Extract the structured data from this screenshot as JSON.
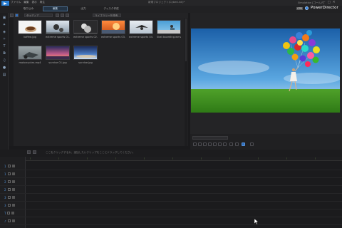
{
  "window": {
    "title": "新規プロジェクト(CyberLink)*",
    "controls": [
      "—",
      "□",
      "✕"
    ]
  },
  "menu": [
    "ファイル",
    "編集",
    "表示",
    "再生"
  ],
  "modes": {
    "capture": "取り込み",
    "edit": "編集",
    "produce": "出力",
    "disc": "ディスク作成"
  },
  "brand": {
    "user": "Simulation [ゴールド]",
    "badge": "CPR",
    "name": "PowerDirector"
  },
  "library": {
    "filter_label": "全メディア",
    "search_placeholder": "ライブラリーを検索",
    "items": [
      {
        "label": "kaffee.jpg"
      },
      {
        "label": "extreme sports 01.jpg"
      },
      {
        "label": "extreme sports 02.jpg"
      },
      {
        "label": "extreme sports 03.jpg"
      },
      {
        "label": "extreme sports 04.jpg"
      },
      {
        "label": "Skat boarding.wmv"
      },
      {
        "label": "motorcycles.mp4"
      },
      {
        "label": "sunrise 01.jpg"
      },
      {
        "label": "sunrise.jpg"
      }
    ]
  },
  "timeline": {
    "hint": "ここをクリックするか、追加したいクリップをここにドラッグしてください。",
    "tracks": [
      "1",
      "1",
      "2",
      "2",
      "3",
      "3",
      "T",
      "♪"
    ]
  },
  "accent": "#2e6fc0"
}
